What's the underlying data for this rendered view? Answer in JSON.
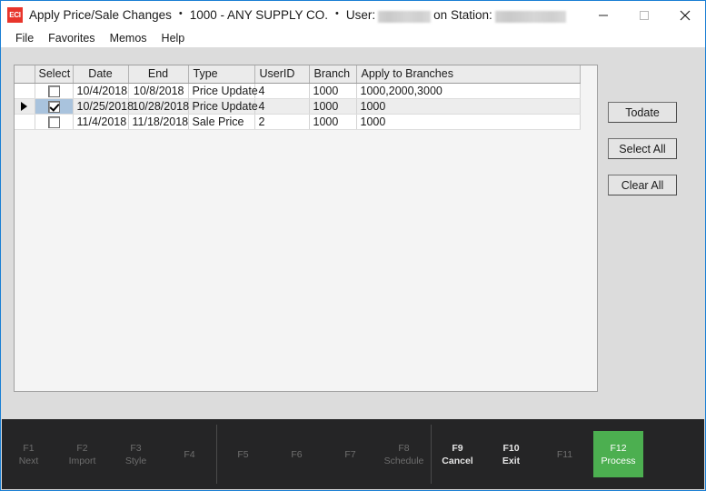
{
  "window": {
    "logo_text": "ECI",
    "title_app": "Apply Price/Sale Changes",
    "bullet": "•",
    "title_company": "1000 - ANY SUPPLY CO.",
    "title_user_label": "User:",
    "title_station_label": "on Station:",
    "accent_color": "#1a7fd4"
  },
  "window_controls": {
    "minimize": "minimize-icon",
    "maximize": "maximize-icon",
    "close": "close-icon"
  },
  "menubar": {
    "items": [
      {
        "label": "File"
      },
      {
        "label": "Favorites"
      },
      {
        "label": "Memos"
      },
      {
        "label": "Help"
      }
    ]
  },
  "grid": {
    "columns": [
      {
        "key": "indicator",
        "label": ""
      },
      {
        "key": "select",
        "label": "Select"
      },
      {
        "key": "date",
        "label": "Date"
      },
      {
        "key": "end",
        "label": "End"
      },
      {
        "key": "type",
        "label": "Type"
      },
      {
        "key": "userid",
        "label": "UserID"
      },
      {
        "key": "branch",
        "label": "Branch"
      },
      {
        "key": "apply",
        "label": "Apply to Branches"
      }
    ],
    "rows": [
      {
        "selected_row": false,
        "checked": false,
        "date": "10/4/2018",
        "end": "10/8/2018",
        "type": "Price Update",
        "userid": "4",
        "branch": "1000",
        "apply": "1000,2000,3000"
      },
      {
        "selected_row": true,
        "checked": true,
        "date": "10/25/2018",
        "end": "10/28/2018",
        "type": "Price Update",
        "userid": "4",
        "branch": "1000",
        "apply": "1000"
      },
      {
        "selected_row": false,
        "checked": false,
        "date": "11/4/2018",
        "end": "11/18/2018",
        "type": "Sale Price",
        "userid": "2",
        "branch": "1000",
        "apply": "1000"
      }
    ]
  },
  "side_buttons": [
    {
      "label": "Todate"
    },
    {
      "label": "Select All"
    },
    {
      "label": "Clear All"
    }
  ],
  "function_bar": {
    "accent_color": "#4caf50",
    "groups": [
      {
        "keys": [
          {
            "key": "F1",
            "label": "Next",
            "state": "dim"
          },
          {
            "key": "F2",
            "label": "Import",
            "state": "dim"
          },
          {
            "key": "F3",
            "label": "Style",
            "state": "dim"
          },
          {
            "key": "F4",
            "label": "",
            "state": "dim"
          }
        ]
      },
      {
        "keys": [
          {
            "key": "F5",
            "label": "",
            "state": "dim"
          },
          {
            "key": "F6",
            "label": "",
            "state": "dim"
          },
          {
            "key": "F7",
            "label": "",
            "state": "dim"
          },
          {
            "key": "F8",
            "label": "Schedule",
            "state": "dim"
          }
        ]
      },
      {
        "keys": [
          {
            "key": "F9",
            "label": "Cancel",
            "state": "enabled"
          },
          {
            "key": "F10",
            "label": "Exit",
            "state": "enabled"
          },
          {
            "key": "F11",
            "label": "",
            "state": "dim"
          },
          {
            "key": "F12",
            "label": "Process",
            "state": "accent"
          }
        ]
      }
    ]
  }
}
